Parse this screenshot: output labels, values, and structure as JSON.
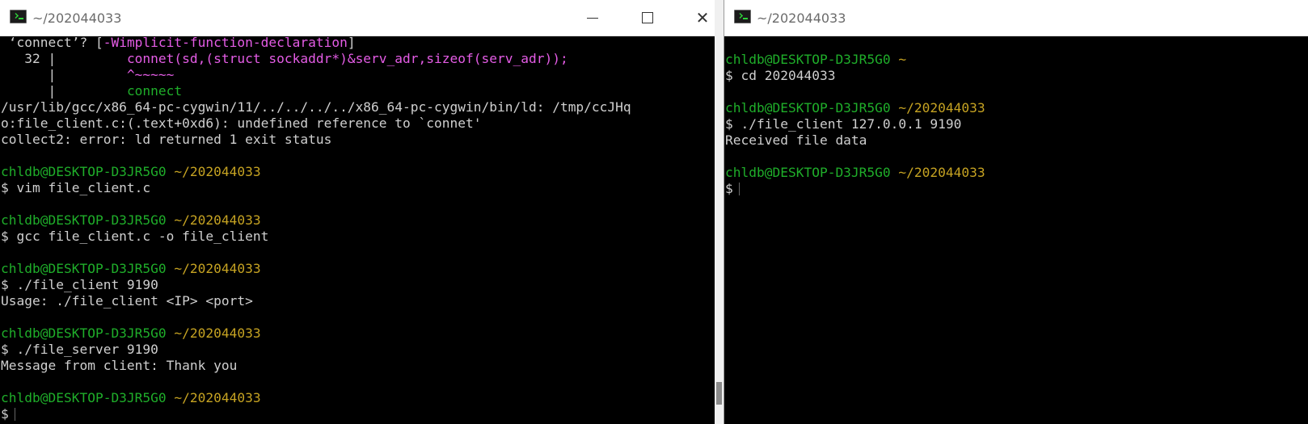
{
  "windows": [
    {
      "title": "~/202044033"
    },
    {
      "title": "~/202044033"
    }
  ],
  "left_terminal": {
    "lines": [
      {
        "prefix": " ‘connect’? [",
        "flag": "-Wimplicit-function-declaration",
        "suffix": "]"
      },
      {
        "gutter": "   32 |         ",
        "code": "connet(sd,(struct sockaddr*)&serv_adr,sizeof(serv_adr));"
      },
      {
        "gutter": "      |         ",
        "code": "^~~~~~"
      },
      {
        "gutter": "      |         ",
        "code": "connect"
      },
      {
        "text": "/usr/lib/gcc/x86_64-pc-cygwin/11/../../../../x86_64-pc-cygwin/bin/ld: /tmp/ccJHq"
      },
      {
        "text": "o:file_client.c:(.text+0xd6): undefined reference to `connet'"
      },
      {
        "text": "collect2: error: ld returned 1 exit status"
      },
      {
        "text": ""
      },
      {
        "user": "chldb@DESKTOP-D3JR5G0",
        "path": "~/202044033"
      },
      {
        "text": "$ vim file_client.c"
      },
      {
        "text": ""
      },
      {
        "user": "chldb@DESKTOP-D3JR5G0",
        "path": "~/202044033"
      },
      {
        "text": "$ gcc file_client.c -o file_client"
      },
      {
        "text": ""
      },
      {
        "user": "chldb@DESKTOP-D3JR5G0",
        "path": "~/202044033"
      },
      {
        "text": "$ ./file_client 9190"
      },
      {
        "text": "Usage: ./file_client <IP> <port>"
      },
      {
        "text": ""
      },
      {
        "user": "chldb@DESKTOP-D3JR5G0",
        "path": "~/202044033"
      },
      {
        "text": "$ ./file_server 9190"
      },
      {
        "text": "Message from client: Thank you"
      },
      {
        "text": ""
      },
      {
        "user": "chldb@DESKTOP-D3JR5G0",
        "path": "~/202044033"
      },
      {
        "prompt": "$"
      }
    ]
  },
  "right_terminal": {
    "lines": [
      {
        "user": "chldb@DESKTOP-D3JR5G0",
        "path": "~"
      },
      {
        "text": "$ cd 202044033"
      },
      {
        "text": ""
      },
      {
        "user": "chldb@DESKTOP-D3JR5G0",
        "path": "~/202044033"
      },
      {
        "text": "$ ./file_client 127.0.0.1 9190"
      },
      {
        "text": "Received file data"
      },
      {
        "text": ""
      },
      {
        "user": "chldb@DESKTOP-D3JR5G0",
        "path": "~/202044033"
      },
      {
        "prompt": "$"
      }
    ]
  },
  "colors": {
    "user": "#1fae2a",
    "path": "#c6a322",
    "flag": "#e45ce5",
    "text": "#cfcfcf",
    "background": "#000000"
  },
  "icons": [
    "terminal-icon",
    "minimize-icon",
    "maximize-icon",
    "close-icon"
  ]
}
